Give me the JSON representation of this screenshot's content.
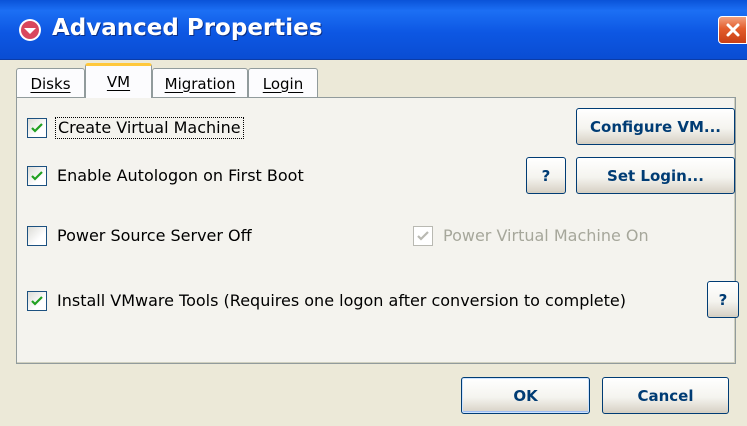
{
  "window": {
    "title": "Advanced Properties",
    "icon": "app-icon",
    "close_label": "×"
  },
  "tabs": [
    {
      "label": "Disks",
      "active": false
    },
    {
      "label": "VM",
      "active": true
    },
    {
      "label": "Migration",
      "active": false
    },
    {
      "label": "Login",
      "active": false
    }
  ],
  "options": {
    "create_vm": {
      "label": "Create Virtual Machine",
      "checked": true,
      "focused": true
    },
    "autologon": {
      "label": "Enable Autologon on First Boot",
      "checked": true
    },
    "power_source_off": {
      "label": "Power Source Server Off",
      "checked": false
    },
    "power_vm_on": {
      "label": "Power Virtual Machine On",
      "checked": true,
      "disabled": true
    },
    "install_tools": {
      "label": "Install VMware Tools (Requires one logon after conversion to complete)",
      "checked": true
    }
  },
  "buttons": {
    "configure_vm": "Configure VM...",
    "help_autologon": "?",
    "set_login": "Set Login...",
    "help_tools": "?",
    "ok": "OK",
    "cancel": "Cancel"
  },
  "colors": {
    "title_bar": "#0d57e3",
    "window_face": "#ece9d8",
    "tab_highlight": "#ffc83c",
    "button_text": "#003c74",
    "checkmark": "#21a121"
  }
}
